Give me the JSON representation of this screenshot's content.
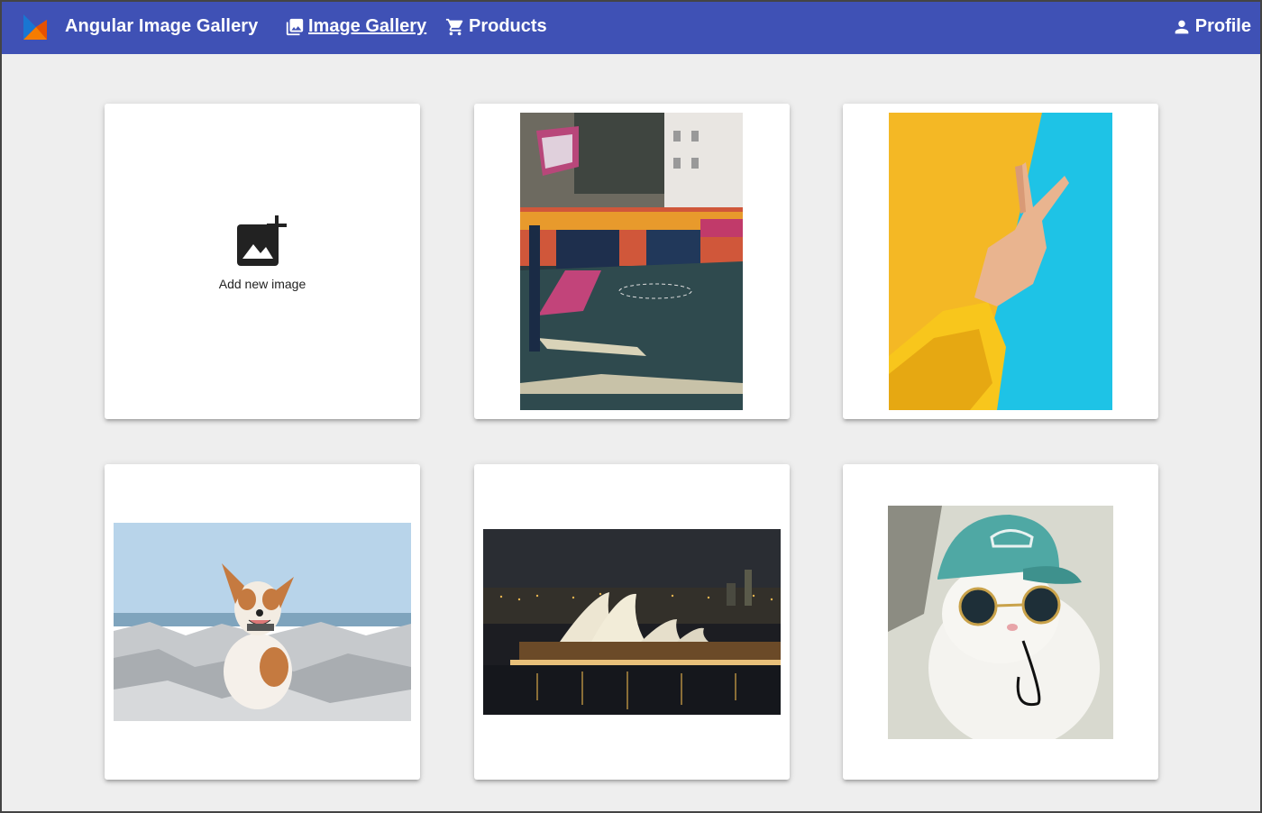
{
  "app": {
    "title": "Angular Image Gallery"
  },
  "nav": {
    "gallery_label": "Image Gallery",
    "products_label": "Products",
    "profile_label": "Profile"
  },
  "add_card": {
    "label": "Add new image",
    "icon": "add-photo-icon"
  },
  "gallery": {
    "images": [
      {
        "subject": "basketball court"
      },
      {
        "subject": "peace hand sign"
      },
      {
        "subject": "dog on rocks"
      },
      {
        "subject": "sydney opera house at night"
      },
      {
        "subject": "cat with cap and sunglasses"
      }
    ]
  },
  "colors": {
    "toolbar": "#3f51b5",
    "background": "#eeeeee",
    "card": "#ffffff"
  }
}
